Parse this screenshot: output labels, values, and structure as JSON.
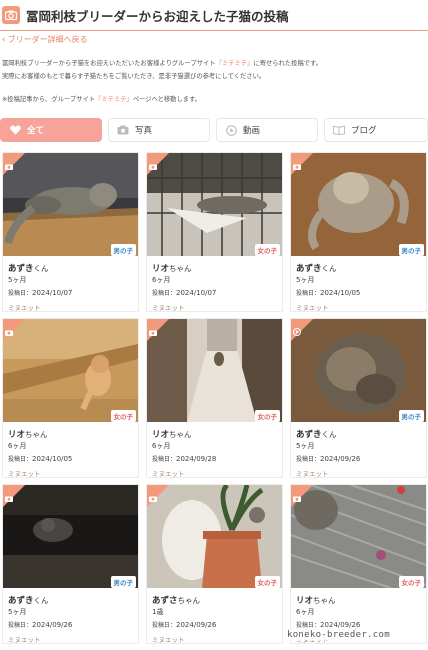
{
  "header": {
    "title": "冨岡利枝ブリーダーからお迎えした子猫の投稿"
  },
  "back_link": "ブリーダー詳細へ戻る",
  "intro": {
    "line1_a": "冨岡利枝ブリーダーから子猫をお迎えいただいたお客様よりグループサイト",
    "line1_hl": "『ミテミテ』",
    "line1_b": "に寄せられた投稿です。",
    "line2": "実際にお客様のもとで暮らす子猫たちをご覧いただき、是非子猫選びの参考にしてください。",
    "line3_a": "※投稿記事から、グループサイト",
    "line3_hl": "『ミテミテ』",
    "line3_b": "ページへと移動します。"
  },
  "tabs": [
    {
      "label": "全て",
      "icon": "heart-icon"
    },
    {
      "label": "写真",
      "icon": "camera-icon"
    },
    {
      "label": "動画",
      "icon": "play-icon"
    },
    {
      "label": "ブログ",
      "icon": "book-icon"
    }
  ],
  "colors": {
    "accent": "#f29a7c",
    "active_tab": "#f7a39a",
    "male": "#3a87c8",
    "female": "#e0615a",
    "breed": "#a08a73"
  },
  "date_label": "投稿日：",
  "posts": [
    {
      "name": "あずき",
      "suffix": "くん",
      "age": "5ヶ月",
      "date": "2024/10/07",
      "breed": "ミヌエット",
      "gender": "男の子",
      "gender_type": "male",
      "corner_icon": "camera-icon"
    },
    {
      "name": "リオ",
      "suffix": "ちゃん",
      "age": "6ヶ月",
      "date": "2024/10/07",
      "breed": "ミヌエット",
      "gender": "女の子",
      "gender_type": "female",
      "corner_icon": "camera-icon"
    },
    {
      "name": "あずき",
      "suffix": "くん",
      "age": "5ヶ月",
      "date": "2024/10/05",
      "breed": "ミヌエット",
      "gender": "男の子",
      "gender_type": "male",
      "corner_icon": "camera-icon"
    },
    {
      "name": "リオ",
      "suffix": "ちゃん",
      "age": "6ヶ月",
      "date": "2024/10/05",
      "breed": "ミヌエット",
      "gender": "女の子",
      "gender_type": "female",
      "corner_icon": "camera-icon"
    },
    {
      "name": "リオ",
      "suffix": "ちゃん",
      "age": "6ヶ月",
      "date": "2024/09/28",
      "breed": "ミヌエット",
      "gender": "女の子",
      "gender_type": "female",
      "corner_icon": "camera-icon"
    },
    {
      "name": "あずき",
      "suffix": "くん",
      "age": "5ヶ月",
      "date": "2024/09/26",
      "breed": "ミヌエット",
      "gender": "男の子",
      "gender_type": "male",
      "corner_icon": "play-icon"
    },
    {
      "name": "あずき",
      "suffix": "くん",
      "age": "5ヶ月",
      "date": "2024/09/26",
      "breed": "ミヌエット",
      "gender": "男の子",
      "gender_type": "male",
      "corner_icon": "camera-icon"
    },
    {
      "name": "あずさ",
      "suffix": "ちゃん",
      "age": "1歳",
      "date": "2024/09/26",
      "breed": "ミヌエット",
      "gender": "女の子",
      "gender_type": "female",
      "corner_icon": "camera-icon"
    },
    {
      "name": "リオ",
      "suffix": "ちゃん",
      "age": "6ヶ月",
      "date": "2024/09/26",
      "breed": "ミヌエット",
      "gender": "女の子",
      "gender_type": "female",
      "corner_icon": "camera-icon"
    }
  ],
  "watermark": "koneko-breeder.com"
}
